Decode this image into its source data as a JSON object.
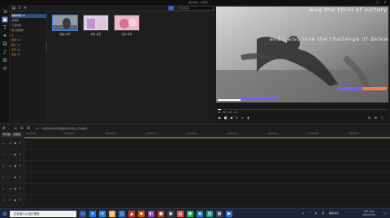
{
  "window": {
    "title": "威力导演 - 新项目"
  },
  "topbar": {
    "search_placeholder": "搜索媒体库"
  },
  "library": {
    "tree": [
      {
        "label": "媒体内容 (3)",
        "selected": true
      },
      {
        "label": "资源库"
      },
      {
        "label": "下载内容"
      },
      {
        "label": "导入的媒体"
      },
      {
        "label": "Q"
      },
      {
        "label": "视频 (2)"
      },
      {
        "label": "照片 (3)"
      },
      {
        "label": "音乐 (0)"
      },
      {
        "label": "色板 (0)"
      }
    ],
    "thumbs": [
      {
        "label": "舞蹈 中景"
      },
      {
        "label": "城市 夜景"
      },
      {
        "label": "花朵 特写"
      }
    ]
  },
  "preview": {
    "caption_line1": "love the thrill of victory",
    "caption_line2": "and I also love the challenge of defeat",
    "timecode": "00 : 00 : 00 : 00",
    "progress": 0.02
  },
  "timeline": {
    "hint": "将一个或更多媒体内容拖放到时间轴上开始编辑。",
    "ruler_ticks": [
      "00:00:00",
      "00:00:04",
      "00:00:08",
      "00:00:12",
      "00:00:16",
      "00:00:20",
      "00:00:24",
      "00:00:28",
      "00:00:32",
      "00:00:36",
      "00:00:40"
    ],
    "head_buttons": [
      "时间轴",
      "故事板"
    ],
    "tracks": [
      "1.",
      "1.",
      "2.",
      "2.",
      "3.",
      "3."
    ]
  },
  "taskbar": {
    "search_placeholder": "在此键入以进行搜索",
    "tray_lang": "英",
    "tray_text": "模拟中文",
    "time": "下午 4:21",
    "date": "2021/11/23"
  },
  "colors": {
    "accent_blue": "#2a5aa5",
    "ruler_gold": "#c9a227",
    "bar_purple": "#7a5cff",
    "bar_orange": "#ff7a4a"
  }
}
